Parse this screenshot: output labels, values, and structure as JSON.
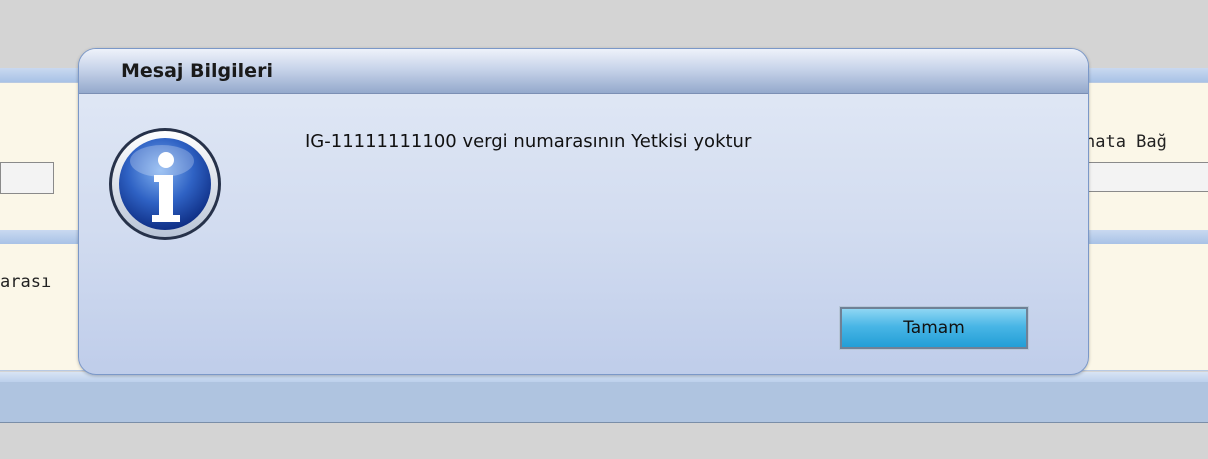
{
  "background": {
    "right_label_fragment": "nata Bağ",
    "left_label_fragment": "arası"
  },
  "dialog": {
    "title": "Mesaj Bilgileri",
    "icon": "info-icon",
    "message": "IG-11111111100 vergi numarasının Yetkisi yoktur",
    "ok_label": "Tamam"
  },
  "colors": {
    "accent": "#2aa3dc",
    "titlebar": "#94a9cc",
    "dialog_body": "#d2dcf0",
    "panel_background": "#fbf7e8"
  }
}
